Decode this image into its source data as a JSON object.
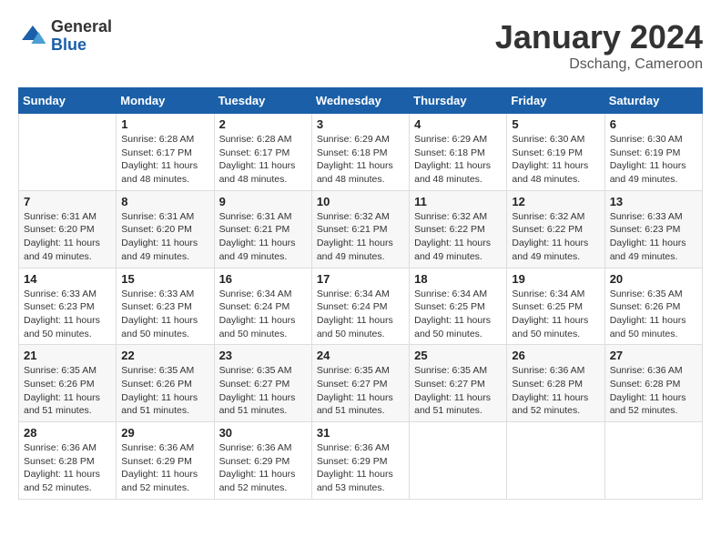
{
  "logo": {
    "general": "General",
    "blue": "Blue"
  },
  "header": {
    "month_year": "January 2024",
    "location": "Dschang, Cameroon"
  },
  "days_of_week": [
    "Sunday",
    "Monday",
    "Tuesday",
    "Wednesday",
    "Thursday",
    "Friday",
    "Saturday"
  ],
  "weeks": [
    [
      null,
      {
        "day": 1,
        "sunrise": "6:28 AM",
        "sunset": "6:17 PM",
        "daylight": "11 hours and 48 minutes."
      },
      {
        "day": 2,
        "sunrise": "6:28 AM",
        "sunset": "6:17 PM",
        "daylight": "11 hours and 48 minutes."
      },
      {
        "day": 3,
        "sunrise": "6:29 AM",
        "sunset": "6:18 PM",
        "daylight": "11 hours and 48 minutes."
      },
      {
        "day": 4,
        "sunrise": "6:29 AM",
        "sunset": "6:18 PM",
        "daylight": "11 hours and 48 minutes."
      },
      {
        "day": 5,
        "sunrise": "6:30 AM",
        "sunset": "6:19 PM",
        "daylight": "11 hours and 48 minutes."
      },
      {
        "day": 6,
        "sunrise": "6:30 AM",
        "sunset": "6:19 PM",
        "daylight": "11 hours and 49 minutes."
      }
    ],
    [
      {
        "day": 7,
        "sunrise": "6:31 AM",
        "sunset": "6:20 PM",
        "daylight": "11 hours and 49 minutes."
      },
      {
        "day": 8,
        "sunrise": "6:31 AM",
        "sunset": "6:20 PM",
        "daylight": "11 hours and 49 minutes."
      },
      {
        "day": 9,
        "sunrise": "6:31 AM",
        "sunset": "6:21 PM",
        "daylight": "11 hours and 49 minutes."
      },
      {
        "day": 10,
        "sunrise": "6:32 AM",
        "sunset": "6:21 PM",
        "daylight": "11 hours and 49 minutes."
      },
      {
        "day": 11,
        "sunrise": "6:32 AM",
        "sunset": "6:22 PM",
        "daylight": "11 hours and 49 minutes."
      },
      {
        "day": 12,
        "sunrise": "6:32 AM",
        "sunset": "6:22 PM",
        "daylight": "11 hours and 49 minutes."
      },
      {
        "day": 13,
        "sunrise": "6:33 AM",
        "sunset": "6:23 PM",
        "daylight": "11 hours and 49 minutes."
      }
    ],
    [
      {
        "day": 14,
        "sunrise": "6:33 AM",
        "sunset": "6:23 PM",
        "daylight": "11 hours and 50 minutes."
      },
      {
        "day": 15,
        "sunrise": "6:33 AM",
        "sunset": "6:23 PM",
        "daylight": "11 hours and 50 minutes."
      },
      {
        "day": 16,
        "sunrise": "6:34 AM",
        "sunset": "6:24 PM",
        "daylight": "11 hours and 50 minutes."
      },
      {
        "day": 17,
        "sunrise": "6:34 AM",
        "sunset": "6:24 PM",
        "daylight": "11 hours and 50 minutes."
      },
      {
        "day": 18,
        "sunrise": "6:34 AM",
        "sunset": "6:25 PM",
        "daylight": "11 hours and 50 minutes."
      },
      {
        "day": 19,
        "sunrise": "6:34 AM",
        "sunset": "6:25 PM",
        "daylight": "11 hours and 50 minutes."
      },
      {
        "day": 20,
        "sunrise": "6:35 AM",
        "sunset": "6:26 PM",
        "daylight": "11 hours and 50 minutes."
      }
    ],
    [
      {
        "day": 21,
        "sunrise": "6:35 AM",
        "sunset": "6:26 PM",
        "daylight": "11 hours and 51 minutes."
      },
      {
        "day": 22,
        "sunrise": "6:35 AM",
        "sunset": "6:26 PM",
        "daylight": "11 hours and 51 minutes."
      },
      {
        "day": 23,
        "sunrise": "6:35 AM",
        "sunset": "6:27 PM",
        "daylight": "11 hours and 51 minutes."
      },
      {
        "day": 24,
        "sunrise": "6:35 AM",
        "sunset": "6:27 PM",
        "daylight": "11 hours and 51 minutes."
      },
      {
        "day": 25,
        "sunrise": "6:35 AM",
        "sunset": "6:27 PM",
        "daylight": "11 hours and 51 minutes."
      },
      {
        "day": 26,
        "sunrise": "6:36 AM",
        "sunset": "6:28 PM",
        "daylight": "11 hours and 52 minutes."
      },
      {
        "day": 27,
        "sunrise": "6:36 AM",
        "sunset": "6:28 PM",
        "daylight": "11 hours and 52 minutes."
      }
    ],
    [
      {
        "day": 28,
        "sunrise": "6:36 AM",
        "sunset": "6:28 PM",
        "daylight": "11 hours and 52 minutes."
      },
      {
        "day": 29,
        "sunrise": "6:36 AM",
        "sunset": "6:29 PM",
        "daylight": "11 hours and 52 minutes."
      },
      {
        "day": 30,
        "sunrise": "6:36 AM",
        "sunset": "6:29 PM",
        "daylight": "11 hours and 52 minutes."
      },
      {
        "day": 31,
        "sunrise": "6:36 AM",
        "sunset": "6:29 PM",
        "daylight": "11 hours and 53 minutes."
      },
      null,
      null,
      null
    ]
  ],
  "labels": {
    "sunrise": "Sunrise:",
    "sunset": "Sunset:",
    "daylight": "Daylight:"
  }
}
